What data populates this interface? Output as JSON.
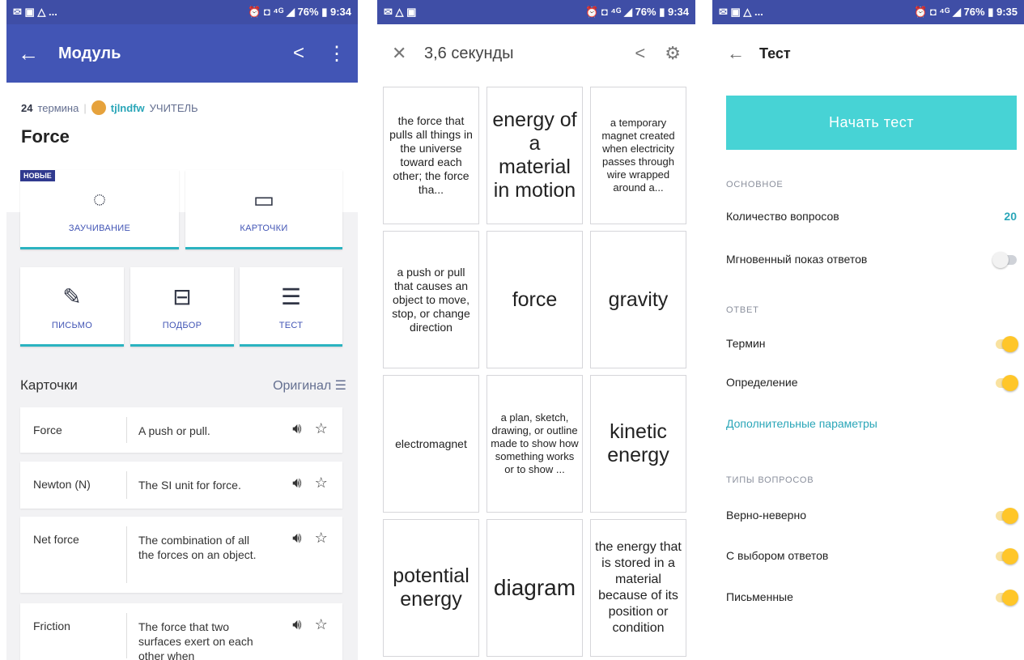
{
  "status_bars": [
    {
      "left": "✉ ▣ △ ...",
      "right": "⏰ ◘ ⁴ᴳ ◢ 76% ▮ 9:34"
    },
    {
      "left": "✉ △ ▣",
      "right": "⏰ ◘ ⁴ᴳ ◢ 76% ▮ 9:34"
    },
    {
      "left": "✉ ▣ △ ...",
      "right": "⏰ ◘ ⁴ᴳ ◢ 76% ▮ 9:35"
    }
  ],
  "module": {
    "appbar_title": "Модуль",
    "terms_count": "24",
    "terms_label": "термина",
    "username": "tjlndfw",
    "role": "УЧИТЕЛЬ",
    "set_title": "Force",
    "new_badge": "НОВЫЕ",
    "modes": [
      {
        "label": "ЗАУЧИВАНИЕ",
        "icon": "learn-icon"
      },
      {
        "label": "КАРТОЧКИ",
        "icon": "flashcards-icon"
      },
      {
        "label": "ПИСЬМО",
        "icon": "write-icon"
      },
      {
        "label": "ПОДБОР",
        "icon": "match-icon"
      },
      {
        "label": "ТЕСТ",
        "icon": "test-icon"
      }
    ],
    "cards_heading": "Карточки",
    "sort_label": "Оригинал",
    "cards": [
      {
        "term": "Force",
        "definition": "A push or pull."
      },
      {
        "term": "Newton (N)",
        "definition": "The SI unit for force."
      },
      {
        "term": "Net force",
        "definition": "The combination of all the forces on an object."
      },
      {
        "term": "Friction",
        "definition": "The force that two surfaces exert on each other when"
      }
    ]
  },
  "match": {
    "timer": "3,6 секунды",
    "tiles": [
      "the force that pulls all things in the universe toward each other; the force tha...",
      "energy of a material in motion",
      "a temporary magnet created when electricity passes through wire wrapped around a...",
      "a push or pull that causes an object to move, stop, or change direction",
      "force",
      "gravity",
      "electromagnet",
      "a plan, sketch, drawing, or outline made to show how something works or to show ...",
      "kinetic energy",
      "potential energy",
      "diagram",
      "the energy that is stored in a material because of its position or condition"
    ]
  },
  "test": {
    "title": "Тест",
    "start_button": "Начать тест",
    "section_basic": "ОСНОВНОЕ",
    "question_count_label": "Количество вопросов",
    "question_count": "20",
    "instant_answers": "Мгновенный показ ответов",
    "section_answer": "ОТВЕТ",
    "term_label": "Термин",
    "definition_label": "Определение",
    "advanced_link": "Дополнительные параметры",
    "section_types": "ТИПЫ ВОПРОСОВ",
    "true_false": "Верно-неверно",
    "multiple_choice": "С выбором ответов",
    "written": "Письменные",
    "toggles": {
      "instant": false,
      "term": true,
      "definition": true,
      "true_false": true,
      "multiple_choice": true,
      "written": true
    }
  }
}
